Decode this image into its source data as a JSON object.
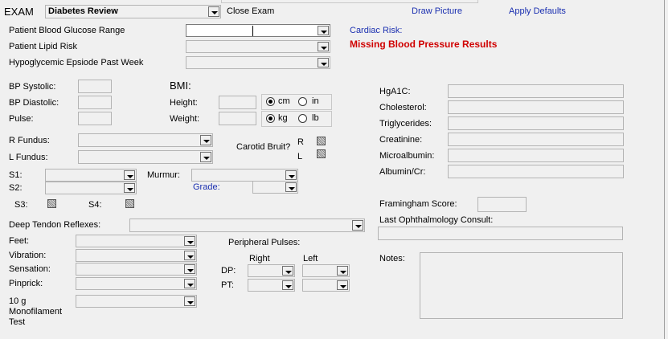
{
  "header": {
    "exam_label": "EXAM",
    "exam_select_value": "Diabetes Review",
    "close_exam": "Close Exam",
    "draw_picture": "Draw Picture",
    "apply_defaults": "Apply Defaults"
  },
  "risk": {
    "glucose_label": "Patient Blood Glucose Range",
    "lipid_label": "Patient Lipid Risk",
    "hypo_label": "Hypoglycemic Epsiode Past  Week",
    "cardiac_risk": "Cardiac Risk:",
    "missing_bp": "Missing Blood Pressure Results"
  },
  "vitals": {
    "bp_systolic": "BP Systolic:",
    "bp_diastolic": "BP Diastolic:",
    "pulse": "Pulse:",
    "bmi": "BMI:",
    "height": "Height:",
    "weight": "Weight:",
    "cm": "cm",
    "in": "in",
    "kg": "kg",
    "lb": "lb"
  },
  "labs": {
    "hga1c": "HgA1C:",
    "cholesterol": "Cholesterol:",
    "triglycerides": "Triglycerides:",
    "creatinine": "Creatinine:",
    "microalbumin": "Microalbumin:",
    "albumin_cr": "Albumin/Cr:",
    "framingham": "Framingham Score:",
    "ophthalmology": "Last Ophthalmology Consult:",
    "notes": "Notes:"
  },
  "exam": {
    "r_fundus": "R Fundus:",
    "l_fundus": "L Fundus:",
    "carotid_bruit": "Carotid Bruit?",
    "r": "R",
    "l": "L",
    "s1": "S1:",
    "s2": "S2:",
    "s3": "S3:",
    "s4": "S4:",
    "murmur": "Murmur:",
    "grade": "Grade:",
    "deep_tendon": "Deep Tendon Reflexes:",
    "feet": "Feet:",
    "vibration": "Vibration:",
    "sensation": "Sensation:",
    "pinprick": "Pinprick:",
    "monofilament": "10 g Monofilament Test",
    "peripheral_pulses": "Peripheral Pulses:",
    "right": "Right",
    "left": "Left",
    "dp": "DP:",
    "pt": "PT:"
  }
}
